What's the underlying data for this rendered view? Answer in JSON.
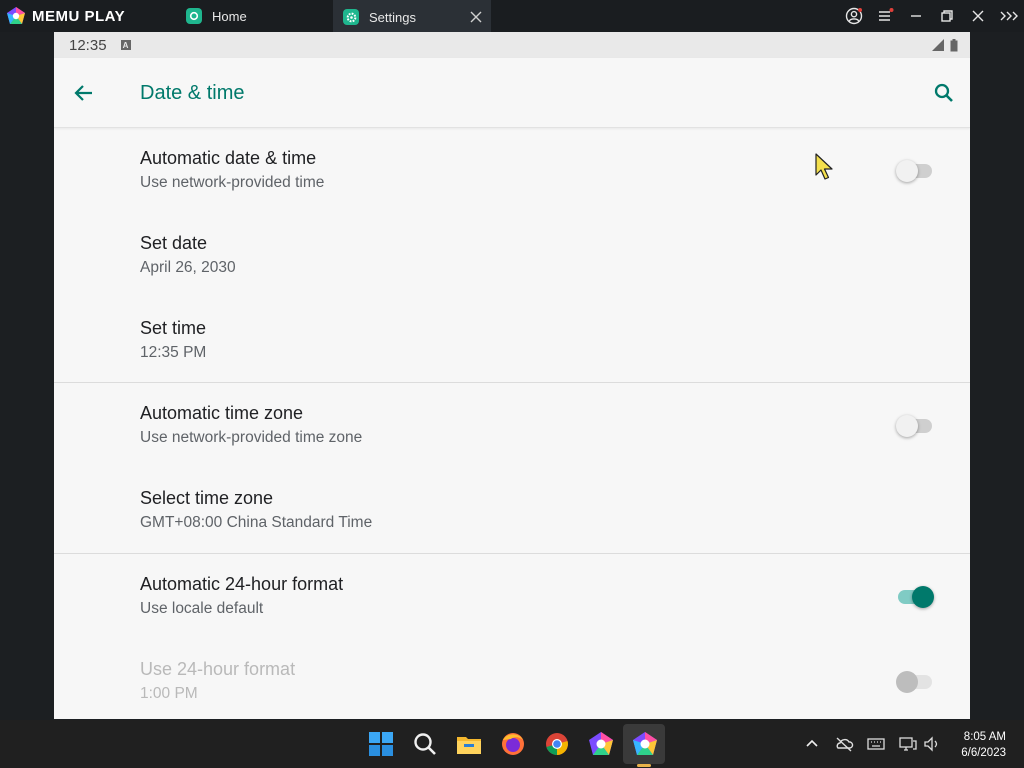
{
  "emulator": {
    "brand": "MEMU PLAY",
    "tabs": [
      {
        "label": "Home",
        "active": false
      },
      {
        "label": "Settings",
        "active": true
      }
    ]
  },
  "android": {
    "status_time": "12:35",
    "screen_title": "Date & time",
    "settings": [
      {
        "label": "Automatic date & time",
        "summary": "Use network-provided time",
        "switch": "off"
      },
      {
        "label": "Set date",
        "summary": "April 26, 2030"
      },
      {
        "label": "Set time",
        "summary": "12:35 PM"
      },
      {
        "label": "Automatic time zone",
        "summary": "Use network-provided time zone",
        "switch": "off"
      },
      {
        "label": "Select time zone",
        "summary": "GMT+08:00 China Standard Time"
      },
      {
        "label": "Automatic 24-hour format",
        "summary": "Use locale default",
        "switch": "on"
      },
      {
        "label": "Use 24-hour format",
        "summary": "1:00 PM",
        "switch": "off",
        "disabled": true
      }
    ],
    "accent_color": "#00796b"
  },
  "taskbar": {
    "clock_time": "8:05 AM",
    "clock_date": "6/6/2023",
    "pinned_apps": [
      "windows-start",
      "search",
      "file-explorer",
      "firefox",
      "chrome",
      "memu-multi",
      "memu-play"
    ]
  }
}
